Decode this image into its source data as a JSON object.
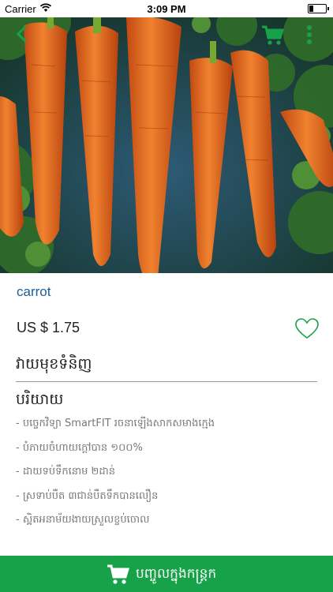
{
  "status_bar": {
    "carrier": "Carrier",
    "time": "3:09 PM"
  },
  "nav": {
    "back_icon": "chevron-left-icon",
    "cart_icon": "cart-icon",
    "more_icon": "more-icon"
  },
  "product": {
    "image_subject": "carrots",
    "name": "carrot",
    "price": "US $ 1.75",
    "favorite_icon": "heart-icon"
  },
  "review_link": "វាយមុខទំនិញ",
  "description": {
    "title": "បរិយាយ",
    "items": [
      "- បច្ចេកវិទ្យា SmartFIT រចនាឡើងសាកសមាងក្មេង",
      "- បំភាយចំហាយក្ដៅបាន ១០០%",
      "- ដាយទប់ទឹកនោម ២ដាន់",
      "- ស្រទាប់បឺត ៣ជាន់បឺតទឹកបានលឿន",
      "- ស្អិតអនាម័យងាយស្រួលខ្ចប់ចោល"
    ]
  },
  "add_to_cart": {
    "label": "បញ្ចូលក្នុងកន្ត្រក"
  },
  "colors": {
    "accent_green": "#17a24a",
    "name_blue": "#1a5f9b",
    "divider": "#9a9a9a"
  }
}
